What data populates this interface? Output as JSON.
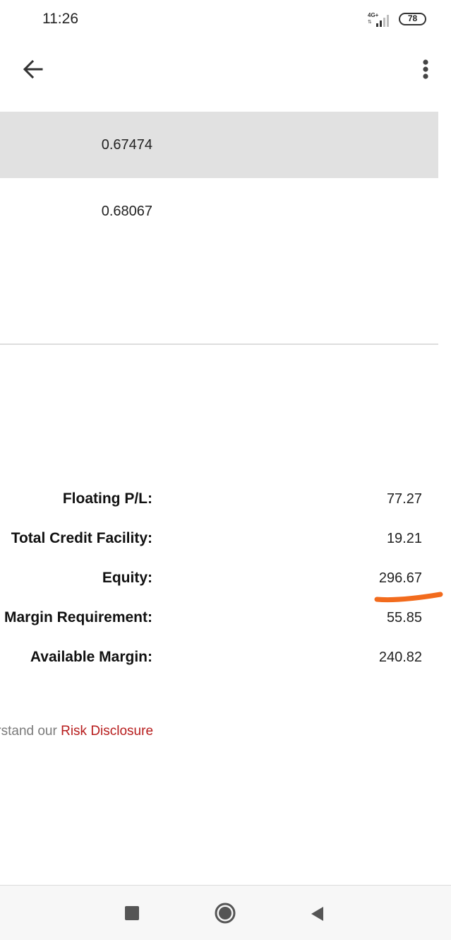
{
  "status_bar": {
    "time": "11:26",
    "network_label": "4G+",
    "battery_level": "78"
  },
  "app_bar": {
    "back_icon": "arrow-left-icon",
    "menu_icon": "more-vertical-icon"
  },
  "rows": [
    {
      "value": "0.67474",
      "highlighted": true
    },
    {
      "value": "0.68067",
      "highlighted": false
    }
  ],
  "summary": [
    {
      "label": "Floating P/L:",
      "value": "77.27"
    },
    {
      "label": "Total Credit Facility:",
      "value": "19.21"
    },
    {
      "label": "Equity:",
      "value": "296.67"
    },
    {
      "label": "Margin Requirement:",
      "value": "55.85"
    },
    {
      "label": "Available Margin:",
      "value": "240.82"
    }
  ],
  "annotation": {
    "color": "#f26b1d",
    "target": "Equity"
  },
  "disclosure": {
    "prefix": "understand our ",
    "link_text": "Risk Disclosure",
    "link_color": "#b71c1c"
  },
  "nav_bar": {
    "recents_icon": "square-icon",
    "home_icon": "circle-icon",
    "back_icon": "triangle-back-icon"
  }
}
